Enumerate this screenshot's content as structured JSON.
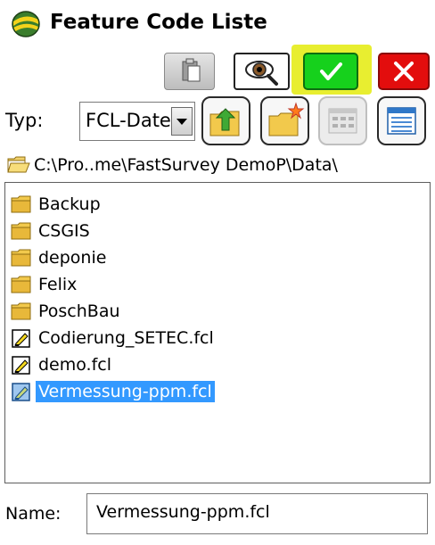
{
  "window": {
    "title": "Feature Code Liste",
    "title_icon": "fastsurvey-logo-icon"
  },
  "toolbar": {
    "paste_icon": "paste-icon",
    "view_icon": "eye-magnifier-icon",
    "ok_icon": "check-icon",
    "cancel_icon": "close-icon",
    "ok_color": "#16d11c",
    "cancel_color": "#e30d0d",
    "highlight_color": "#e8ee30"
  },
  "type_row": {
    "label": "Typ:",
    "selected_value": "FCL-Dateien",
    "buttons": [
      "folder-up-icon",
      "new-folder-icon",
      "list-view-icon",
      "details-view-icon"
    ]
  },
  "path": {
    "text": "C:\\Pro..me\\FastSurvey DemoP\\Data\\"
  },
  "files": [
    {
      "name": "Backup",
      "type": "folder",
      "selected": false
    },
    {
      "name": "CSGIS",
      "type": "folder",
      "selected": false
    },
    {
      "name": "deponie",
      "type": "folder",
      "selected": false
    },
    {
      "name": "Felix",
      "type": "folder",
      "selected": false
    },
    {
      "name": "PoschBau",
      "type": "folder",
      "selected": false
    },
    {
      "name": "Codierung_SETEC.fcl",
      "type": "file",
      "selected": false
    },
    {
      "name": "demo.fcl",
      "type": "file",
      "selected": false
    },
    {
      "name": "Vermessung-ppm.fcl",
      "type": "file",
      "selected": true
    }
  ],
  "name_field": {
    "label": "Name:",
    "value": "Vermessung-ppm.fcl"
  },
  "colors": {
    "selection": "#3399ff"
  }
}
